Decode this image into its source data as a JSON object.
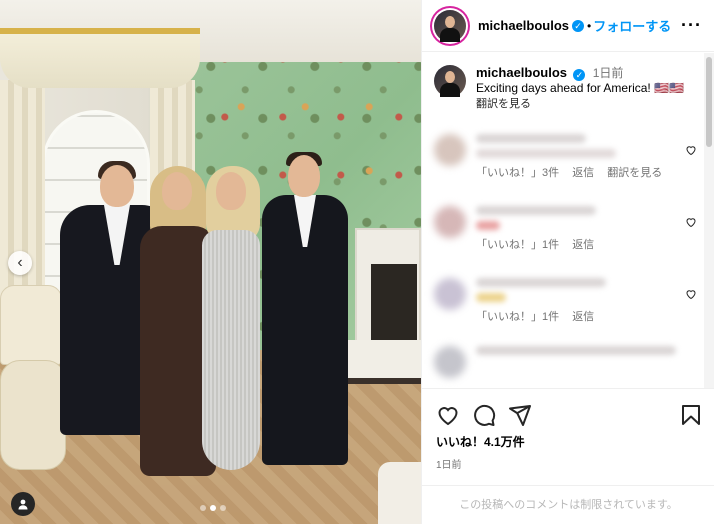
{
  "post": {
    "username": "michaelboulos",
    "follow_label": "フォローする",
    "separator": "•",
    "more_label": "···",
    "verified_mark": "✓"
  },
  "caption": {
    "username": "michaelboulos",
    "time": "1日前",
    "text": "Exciting days ahead for America! 🇺🇸🇺🇸",
    "translate": "翻訳を見る"
  },
  "comments": [
    {
      "likes": "「いいね！」3件",
      "reply": "返信",
      "translate": "翻訳を見る"
    },
    {
      "likes": "「いいね！」1件",
      "reply": "返信"
    },
    {
      "likes": "「いいね！」1件",
      "reply": "返信"
    }
  ],
  "footer": {
    "likes": "いいね！4.1万件",
    "date": "1日前",
    "comments_restricted": "この投稿へのコメントは制限されています。"
  },
  "icons": {
    "heart": "heart-icon",
    "comment": "comment-icon",
    "share": "share-icon",
    "bookmark": "bookmark-icon",
    "nav_prev": "chevron-left-icon",
    "user_tag": "user-tag-icon"
  },
  "colors": {
    "link": "#0095f6",
    "verified": "#0095f6",
    "muted": "#737373"
  },
  "carousel": {
    "slide_count": 3,
    "active_index": 1
  }
}
